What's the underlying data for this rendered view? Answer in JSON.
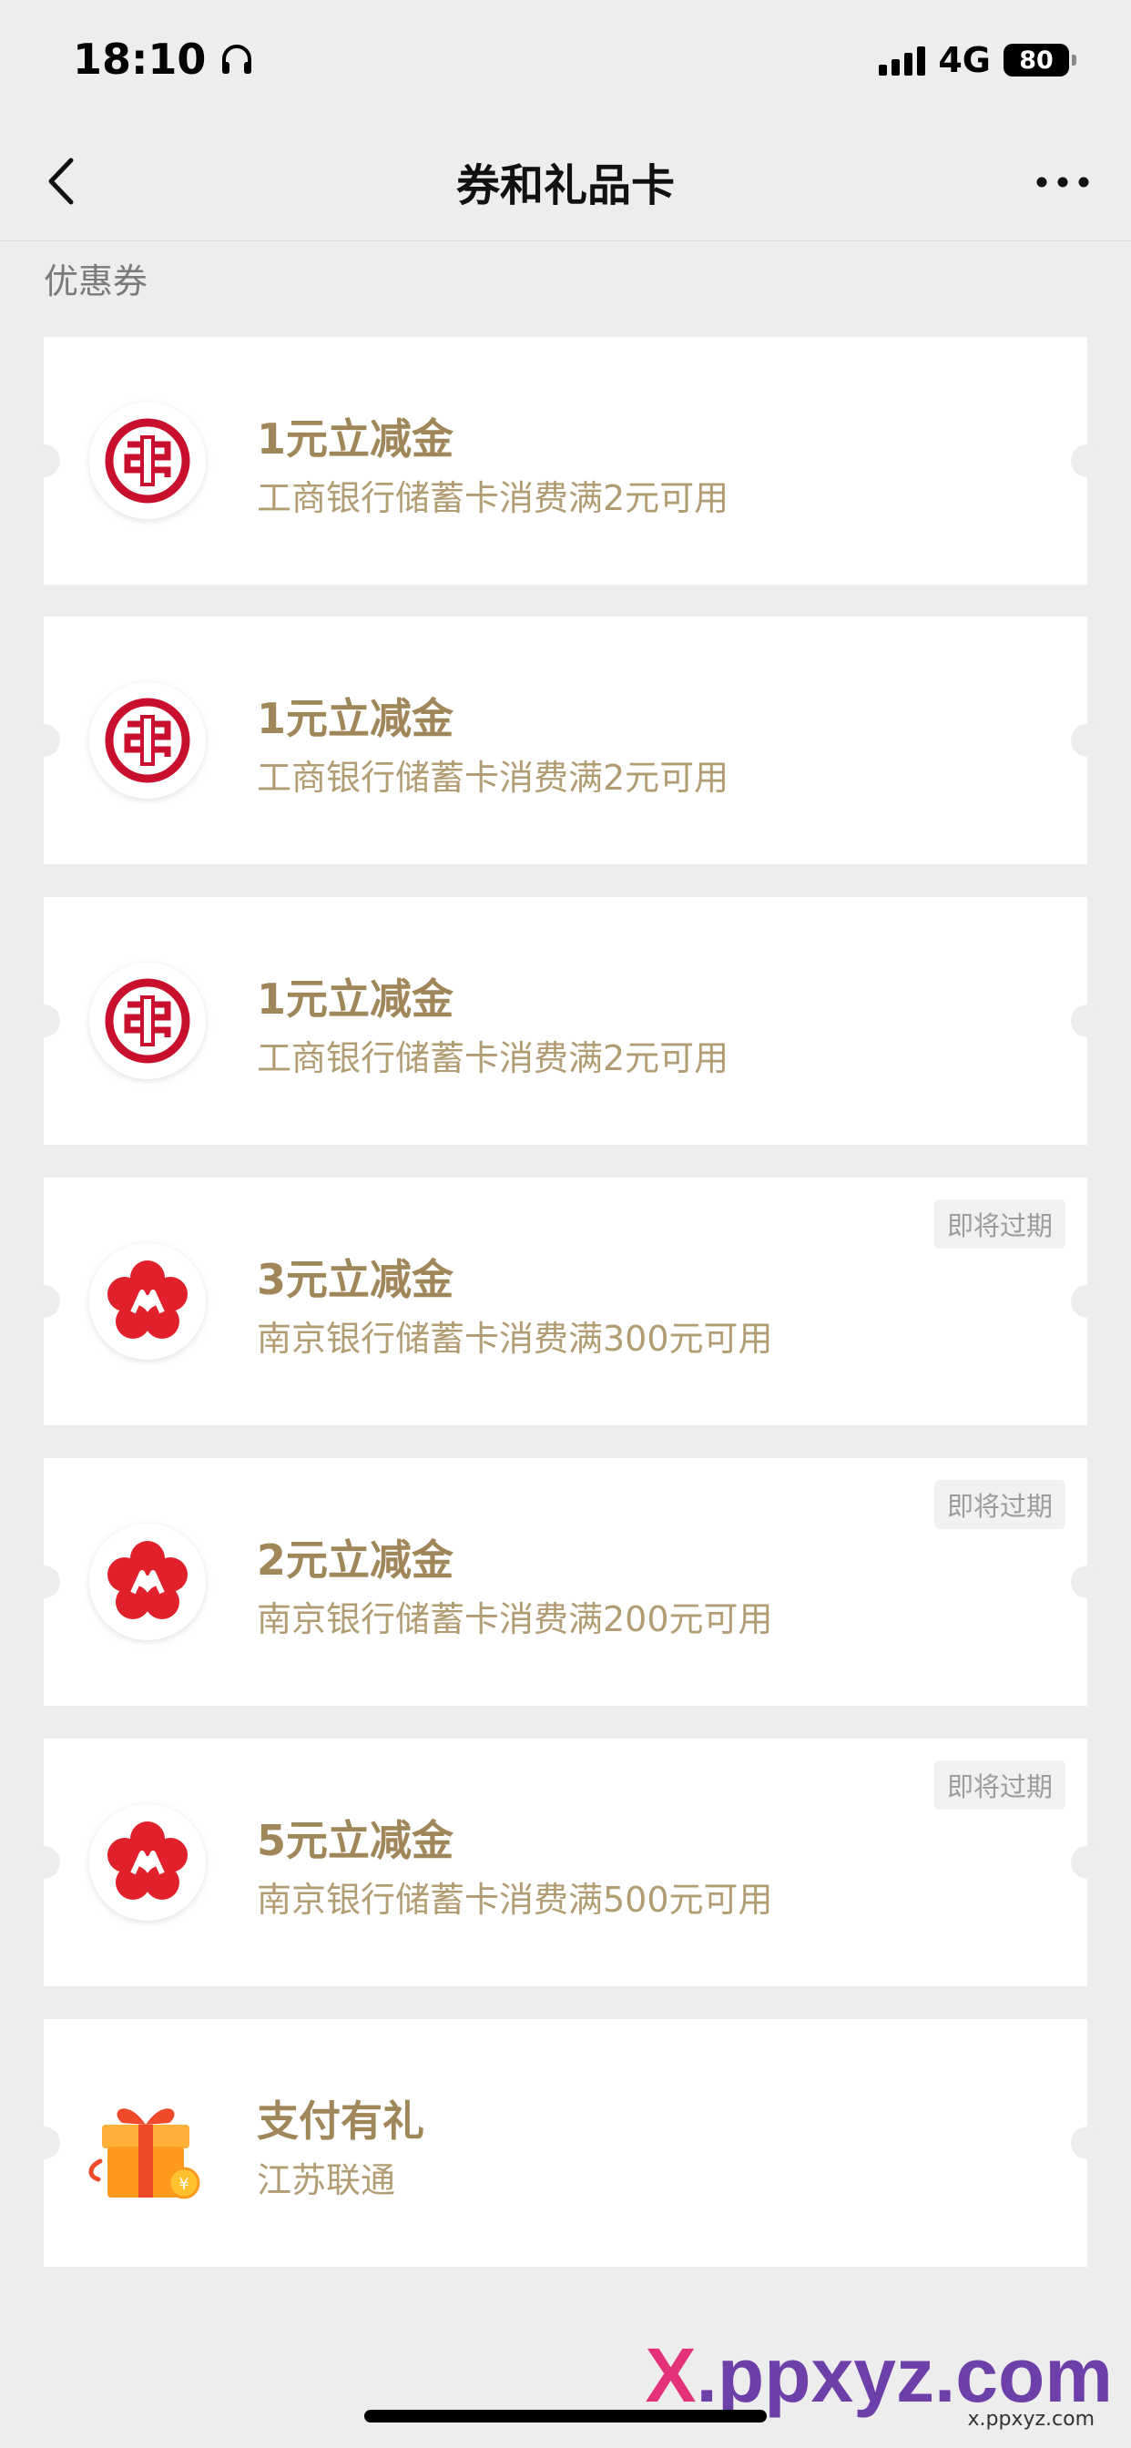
{
  "status_bar": {
    "time": "18:10",
    "network": "4G",
    "battery": "80"
  },
  "nav": {
    "title": "券和礼品卡"
  },
  "section_label": "优惠券",
  "coupons": [
    {
      "title": "1元立减金",
      "desc": "工商银行储蓄卡消费满2元可用",
      "logo": "icbc-logo-icon",
      "badge": ""
    },
    {
      "title": "1元立减金",
      "desc": "工商银行储蓄卡消费满2元可用",
      "logo": "icbc-logo-icon",
      "badge": ""
    },
    {
      "title": "1元立减金",
      "desc": "工商银行储蓄卡消费满2元可用",
      "logo": "icbc-logo-icon",
      "badge": ""
    },
    {
      "title": "3元立减金",
      "desc": "南京银行储蓄卡消费满300元可用",
      "logo": "bank-of-nanjing-logo-icon",
      "badge": "即将过期"
    },
    {
      "title": "2元立减金",
      "desc": "南京银行储蓄卡消费满200元可用",
      "logo": "bank-of-nanjing-logo-icon",
      "badge": "即将过期"
    },
    {
      "title": "5元立减金",
      "desc": "南京银行储蓄卡消费满500元可用",
      "logo": "bank-of-nanjing-logo-icon",
      "badge": "即将过期"
    },
    {
      "title": "支付有礼",
      "desc": "江苏联通",
      "logo": "gift-box-icon",
      "badge": ""
    }
  ],
  "watermark": {
    "x": "X",
    "rest": ".ppxyz.com",
    "sub": "x.ppxyz.com"
  },
  "colors": {
    "background": "#ededed",
    "coupon_text": "#a0875a",
    "icbc_red": "#c8102e",
    "nanjing_red": "#e0202a"
  }
}
